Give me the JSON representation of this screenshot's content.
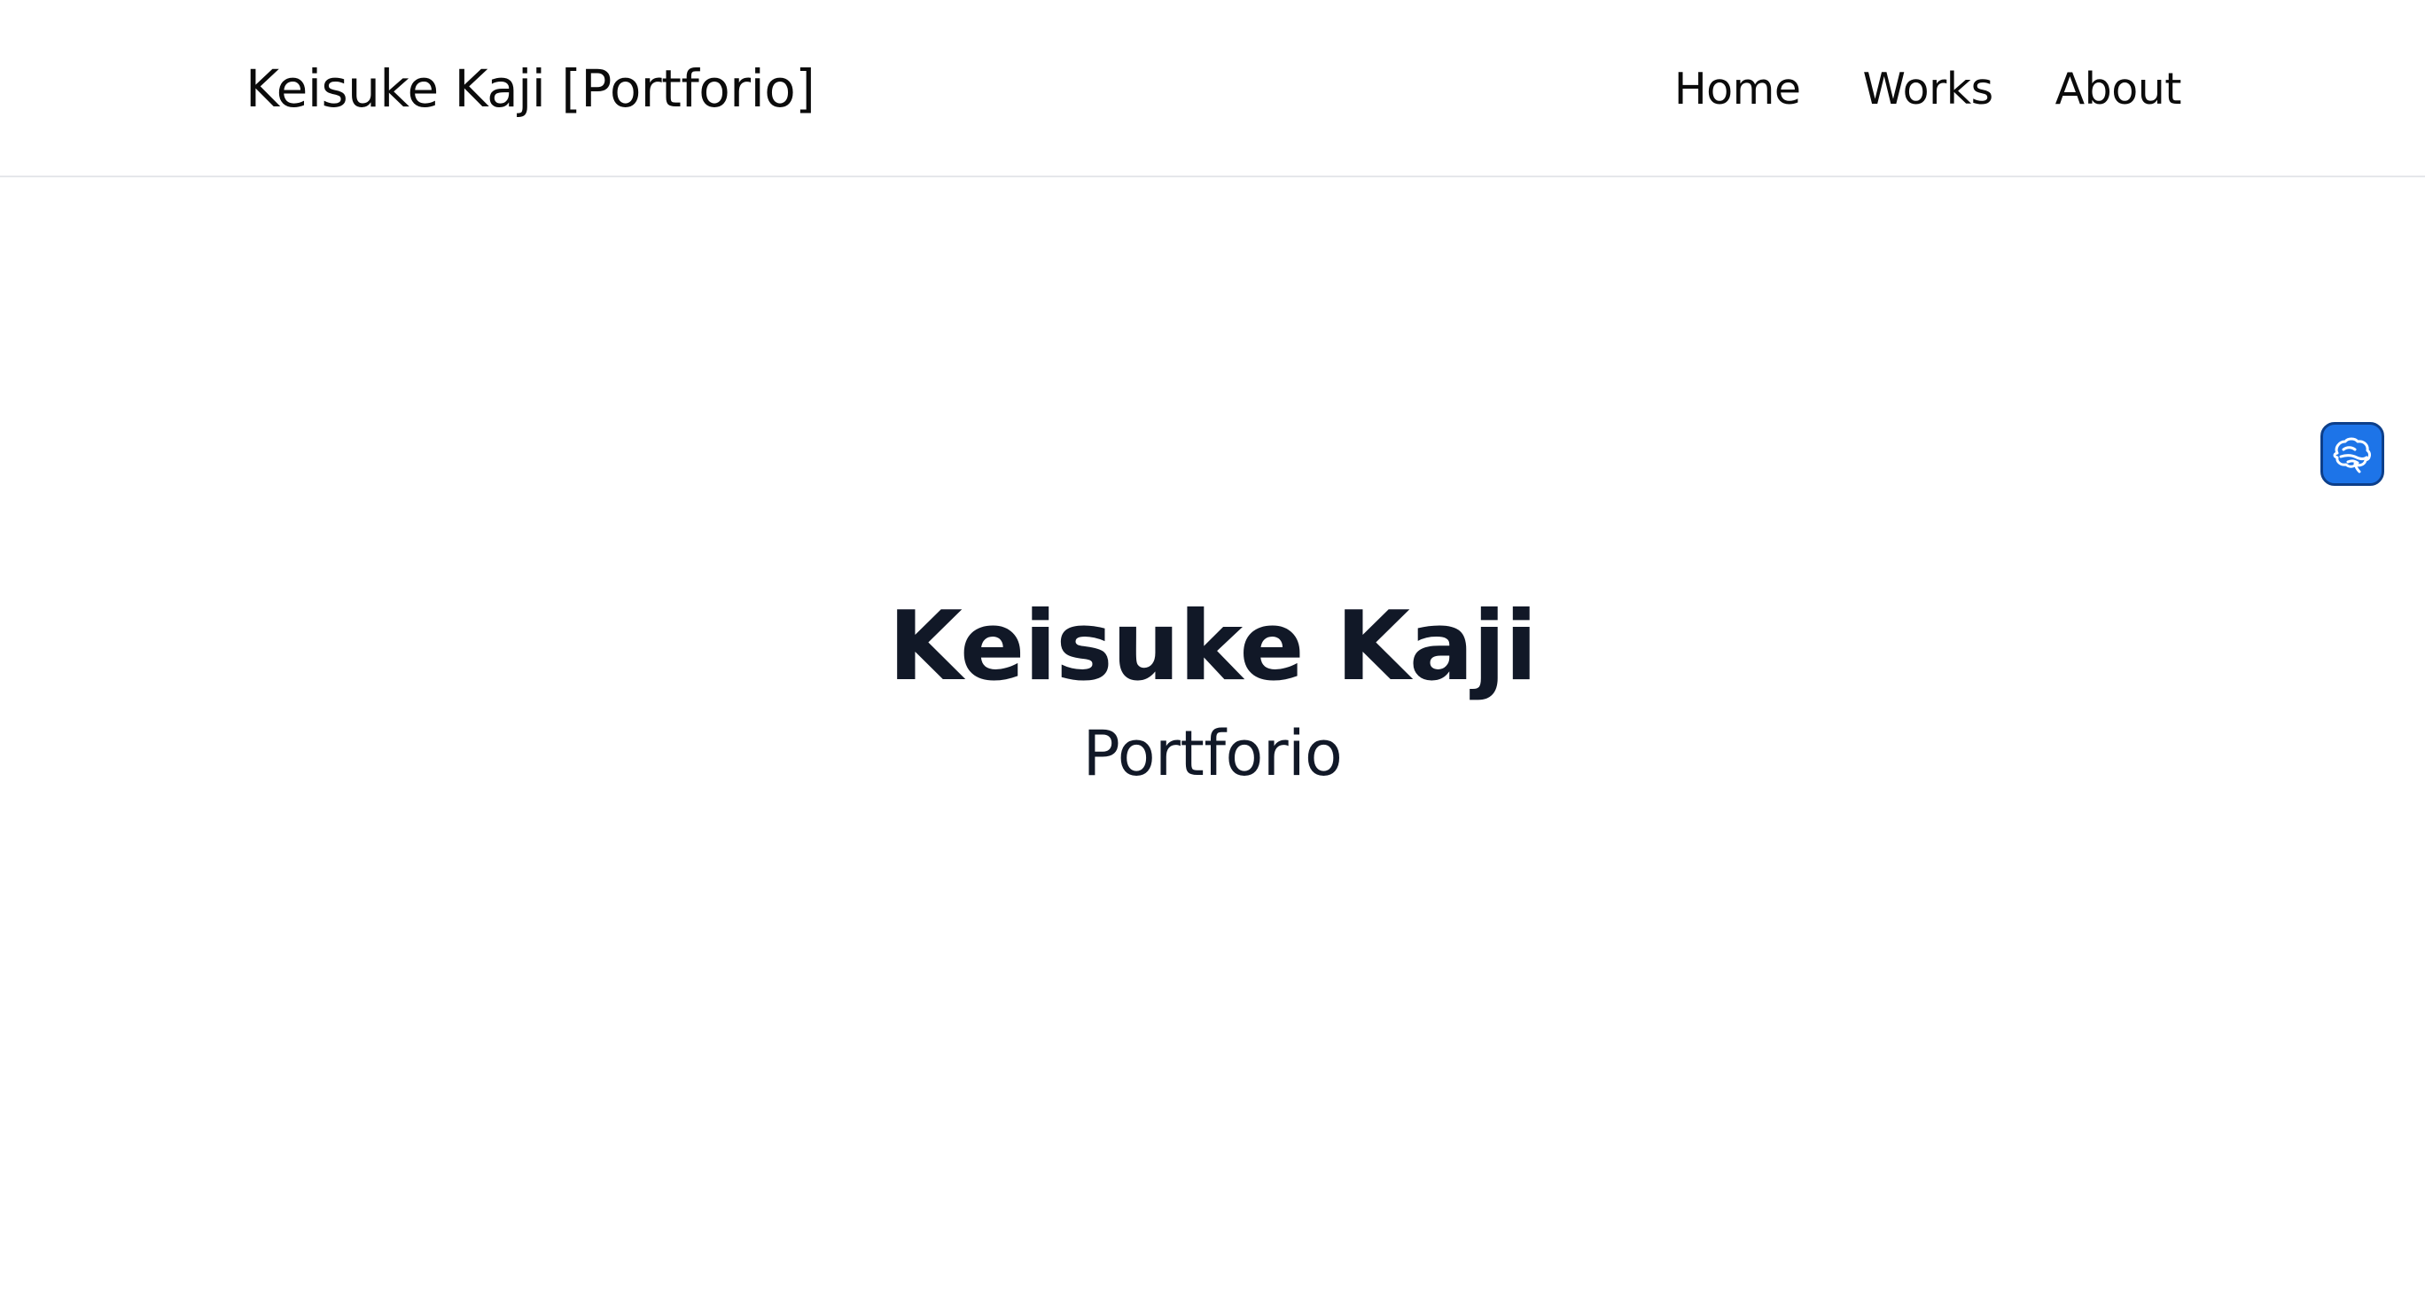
{
  "header": {
    "site_title": "Keisuke Kaji [Portforio]",
    "nav": [
      {
        "label": "Home"
      },
      {
        "label": "Works"
      },
      {
        "label": "About"
      }
    ]
  },
  "hero": {
    "name": "Keisuke Kaji",
    "subtitle": "Portforio"
  },
  "floating_button": {
    "icon": "brain-icon",
    "color": "#1d74e8"
  },
  "colors": {
    "background": "#ffffff",
    "text": "#111827",
    "divider": "#e5e7eb"
  }
}
